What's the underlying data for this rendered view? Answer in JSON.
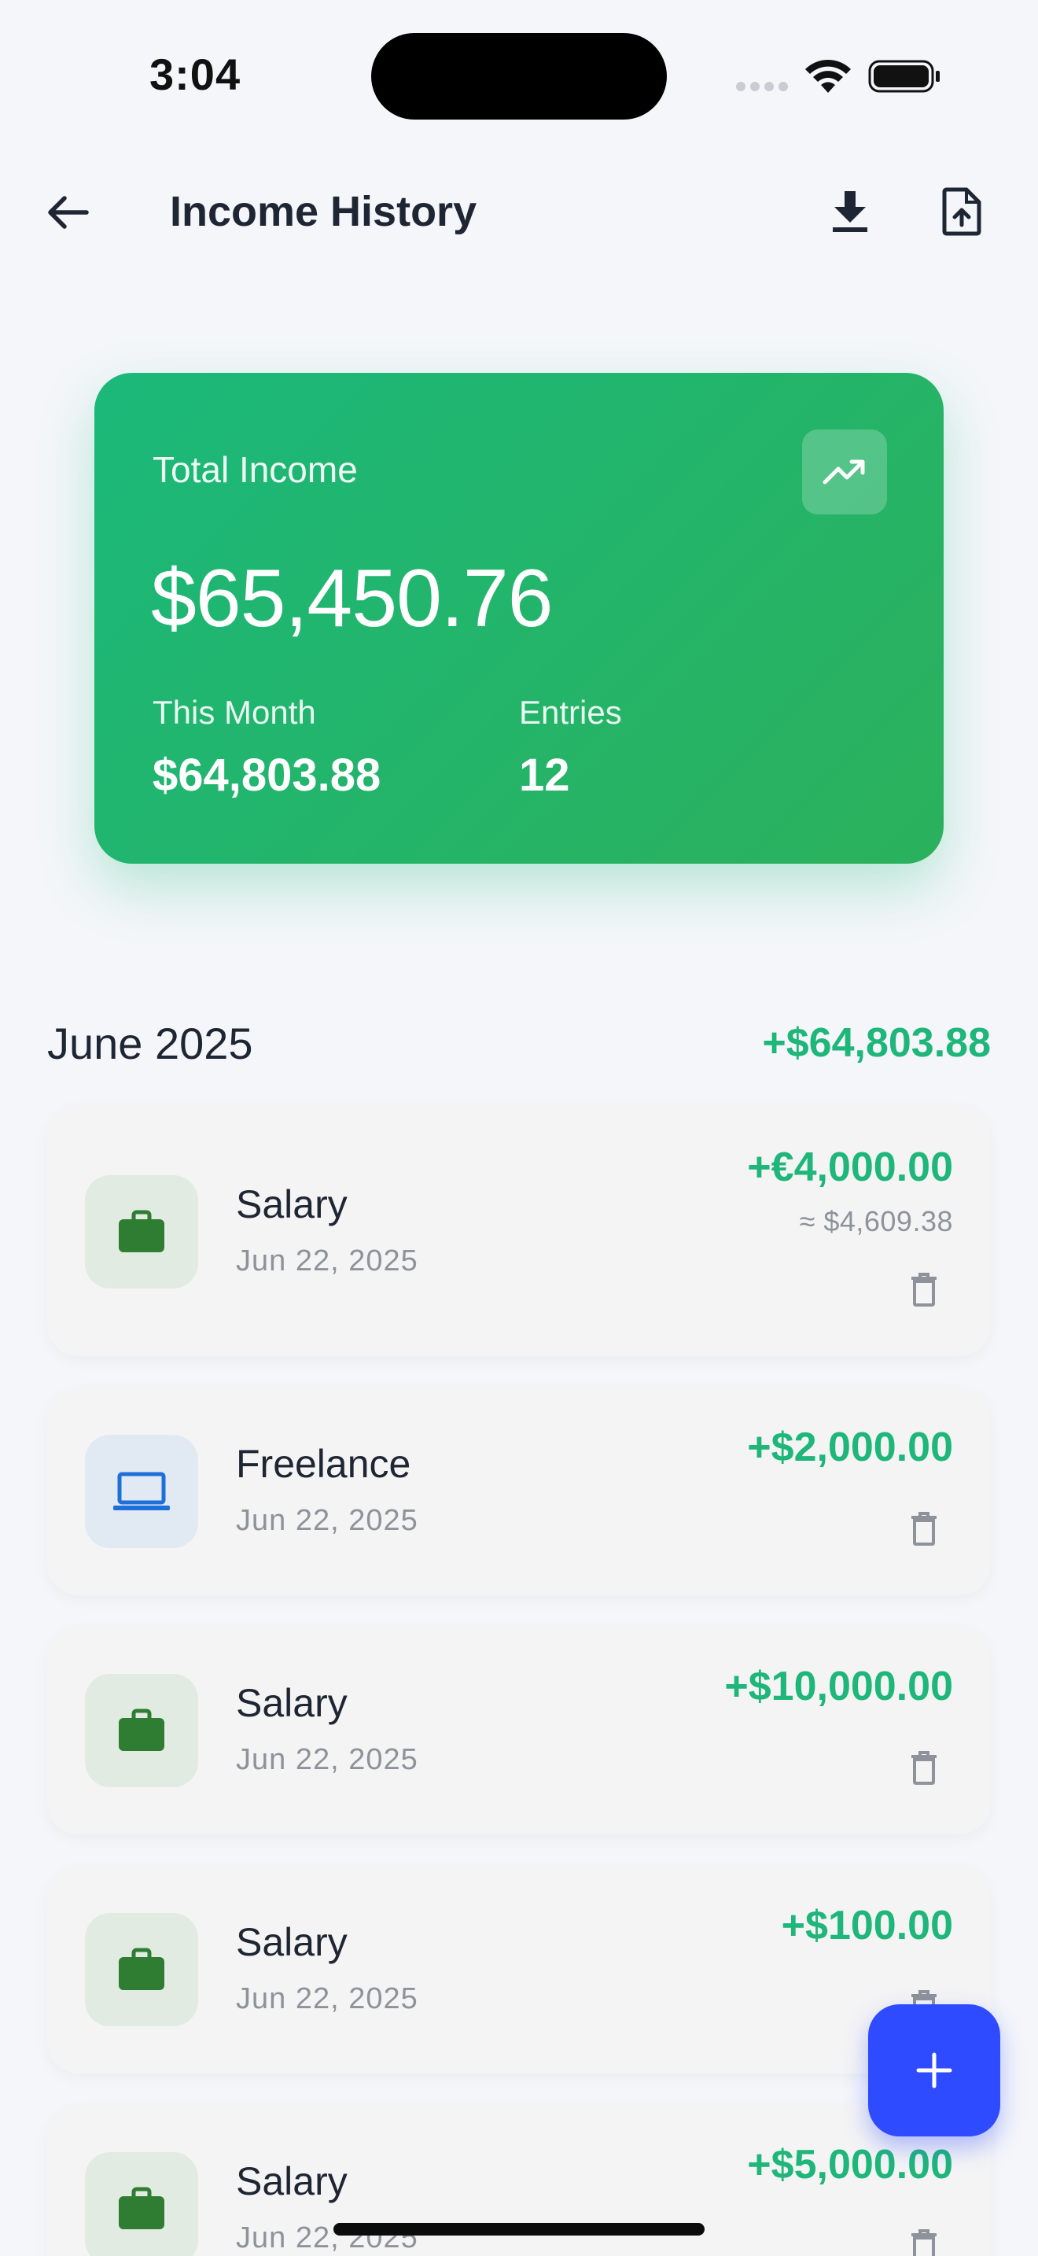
{
  "status_bar": {
    "time": "3:04"
  },
  "header": {
    "title": "Income History",
    "icons": {
      "back": "arrow-left-icon",
      "download": "download-icon",
      "export": "file-upload-icon"
    }
  },
  "summary": {
    "label": "Total Income",
    "total": "$65,450.76",
    "month_label": "This Month",
    "month_value": "$64,803.88",
    "entries_label": "Entries",
    "entries_value": "12",
    "trend_icon": "trending-up-icon"
  },
  "section": {
    "title": "June 2025",
    "total": "+$64,803.88"
  },
  "entries": [
    {
      "title": "Salary",
      "date": "Jun 22, 2025",
      "amount": "+€4,000.00",
      "converted": "≈ $4,609.38",
      "icon": "briefcase-icon"
    },
    {
      "title": "Freelance",
      "date": "Jun 22, 2025",
      "amount": "+$2,000.00",
      "icon": "laptop-icon"
    },
    {
      "title": "Salary",
      "date": "Jun 22, 2025",
      "amount": "+$10,000.00",
      "icon": "briefcase-icon"
    },
    {
      "title": "Salary",
      "date": "Jun 22, 2025",
      "amount": "+$100.00",
      "icon": "briefcase-icon"
    },
    {
      "title": "Salary",
      "date": "Jun 22, 2025",
      "amount": "+$5,000.00",
      "icon": "briefcase-icon"
    }
  ],
  "colors": {
    "accent_green": "#1fb67a",
    "card_gradient_start": "#1bb87a",
    "card_gradient_end": "#2bb15c",
    "fab_blue": "#2f4bff",
    "briefcase_green": "#2e7d32",
    "laptop_blue": "#1e6fd9",
    "background": "#f4f6fa"
  },
  "fab": {
    "icon": "plus-icon"
  }
}
